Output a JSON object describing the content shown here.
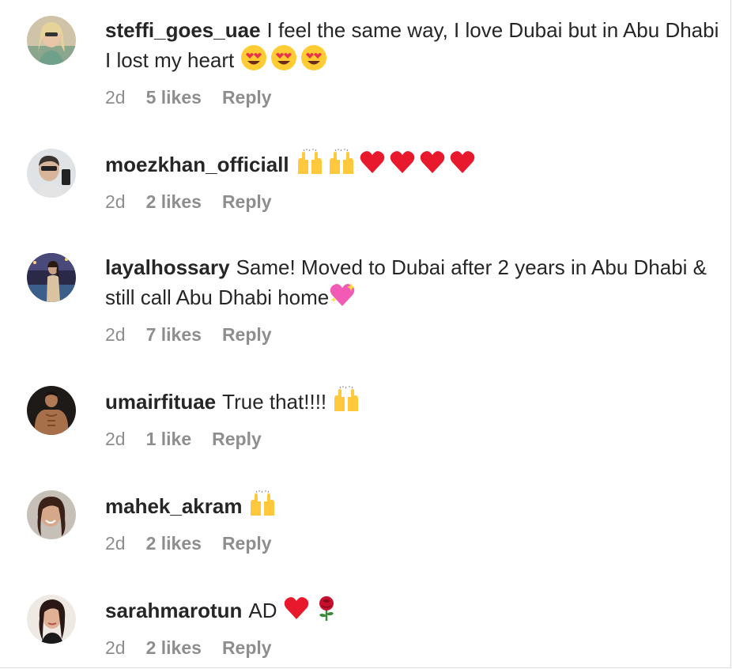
{
  "comments": [
    {
      "username": "steffi_goes_uae",
      "text": "I feel the same way, I love Dubai but in Abu Dhabi I lost my heart",
      "emojis": [
        "heart-eyes",
        "heart-eyes",
        "heart-eyes"
      ],
      "time": "2d",
      "likes": "5 likes",
      "reply": "Reply",
      "avatar_color": "#c9b79a"
    },
    {
      "username": "moezkhan_officiall",
      "text": "",
      "emojis": [
        "raised-hands",
        "raised-hands",
        "red-heart",
        "red-heart",
        "red-heart",
        "red-heart"
      ],
      "time": "2d",
      "likes": "2 likes",
      "reply": "Reply",
      "avatar_color": "#9aa3ad"
    },
    {
      "username": "layalhossary",
      "text": "Same! Moved to Dubai after 2 years in Abu Dhabi & still call Abu Dhabi home",
      "emojis": [
        "sparkling-heart"
      ],
      "time": "2d",
      "likes": "7 likes",
      "reply": "Reply",
      "avatar_color": "#3a3550"
    },
    {
      "username": "umairfituae",
      "text": "True that!!!!",
      "emojis": [
        "raised-hands"
      ],
      "time": "2d",
      "likes": "1 like",
      "reply": "Reply",
      "avatar_color": "#5a3a2a"
    },
    {
      "username": "mahek_akram",
      "text": "",
      "emojis": [
        "raised-hands"
      ],
      "time": "2d",
      "likes": "2 likes",
      "reply": "Reply",
      "avatar_color": "#b89a85"
    },
    {
      "username": "sarahmarotun",
      "text": "AD",
      "emojis": [
        "red-heart",
        "rose"
      ],
      "time": "2d",
      "likes": "2 likes",
      "reply": "Reply",
      "avatar_color": "#6b5a55"
    }
  ]
}
